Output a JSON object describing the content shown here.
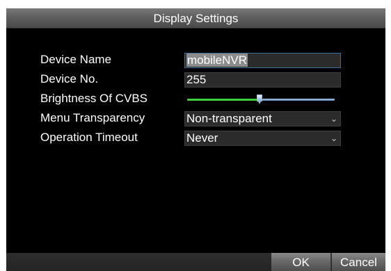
{
  "dialog": {
    "title": "Display Settings"
  },
  "form": {
    "device_name": {
      "label": "Device Name",
      "value": "mobileNVR"
    },
    "device_no": {
      "label": "Device No.",
      "value": "255"
    },
    "brightness": {
      "label": "Brightness Of CVBS",
      "level": 0.47
    },
    "menu_transparency": {
      "label": "Menu Transparency",
      "value": "Non-transparent"
    },
    "operation_timeout": {
      "label": "Operation Timeout",
      "value": "Never"
    }
  },
  "buttons": {
    "ok": "OK",
    "cancel": "Cancel"
  },
  "icons": {
    "dropdown": "chevron-down-icon"
  },
  "colors": {
    "slider_fill": "#3ad13a",
    "slider_rest": "#6f98c5",
    "focus_border": "#3b6f9c"
  }
}
